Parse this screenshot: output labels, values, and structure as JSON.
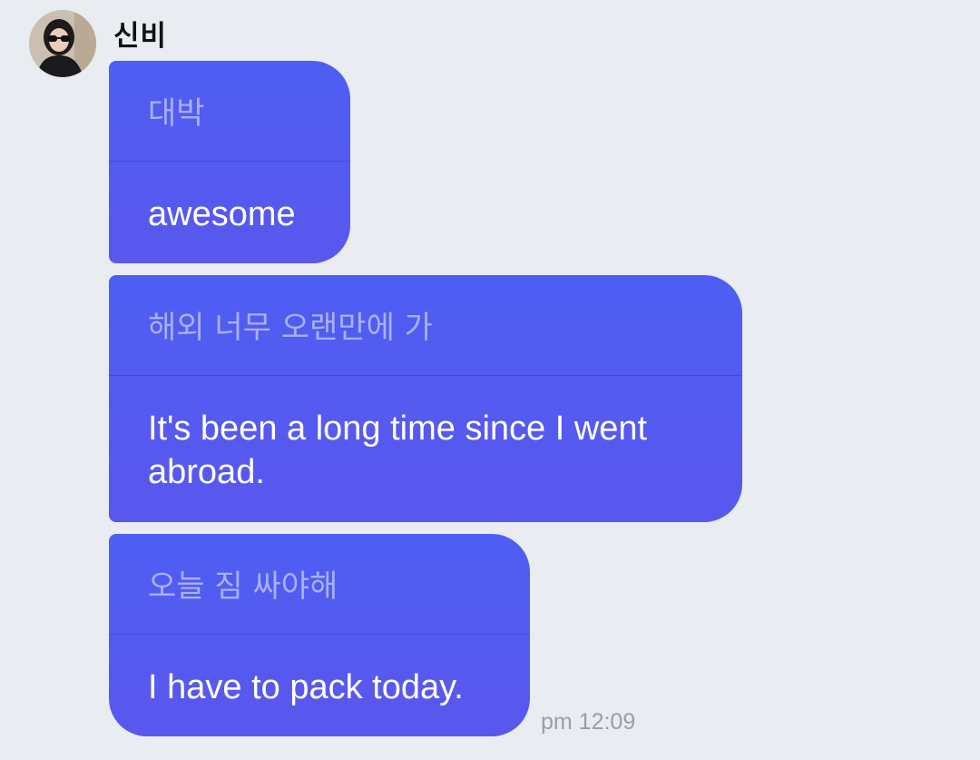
{
  "sender": {
    "name": "신비",
    "avatar_icon": "profile-photo"
  },
  "messages": [
    {
      "original": "대박",
      "translation": "awesome"
    },
    {
      "original": "해외 너무 오랜만에 가",
      "translation": "It's been a long time since I went abroad."
    },
    {
      "original": "오늘 짐 싸야해",
      "translation": "I have to pack today."
    }
  ],
  "timestamp": "pm 12:09",
  "colors": {
    "background": "#e9ecf0",
    "bubble": "#5059f0",
    "original_text": "#a9b0f7",
    "translation_text": "#ffffff",
    "timestamp": "#9a9ea6"
  }
}
